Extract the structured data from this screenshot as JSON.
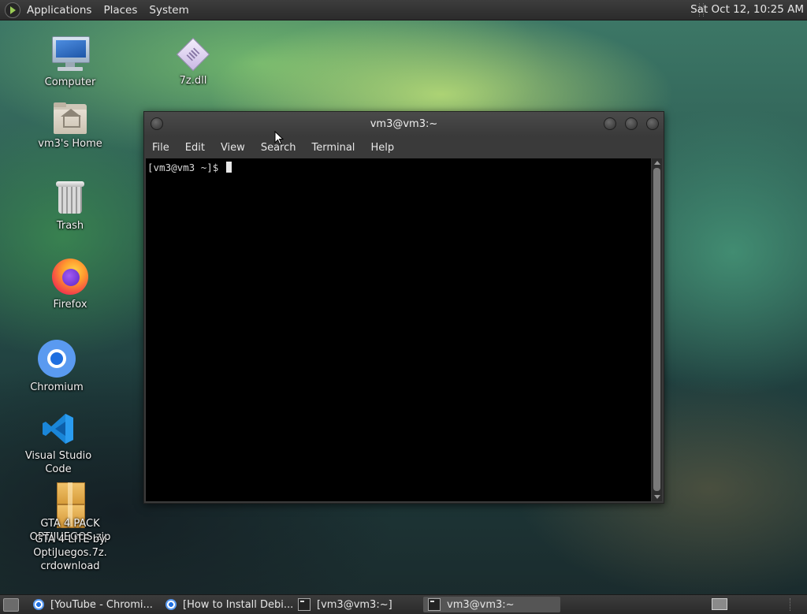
{
  "top_panel": {
    "menus": [
      "Applications",
      "Places",
      "System"
    ],
    "clock": "Sat Oct 12, 10:25 AM"
  },
  "desktop_icons": {
    "computer": "Computer",
    "sevenz": "7z.dll",
    "home": "vm3's Home",
    "trash": "Trash",
    "firefox": "Firefox",
    "chromium": "Chromium",
    "vscode": "Visual Studio Code",
    "gta_line1": "GTA 4 LITE by",
    "gta_line2": "OptiJuegos.7z.",
    "gta_line3": "crdownload",
    "gta_overlap1": "GTA 4 PACK",
    "gta_overlap2": "OPTIJUEGOS.zip"
  },
  "terminal": {
    "title": "vm3@vm3:~",
    "menu": [
      "File",
      "Edit",
      "View",
      "Search",
      "Terminal",
      "Help"
    ],
    "prompt": "[vm3@vm3 ~]$ "
  },
  "taskbar": {
    "tasks": [
      {
        "label": "[YouTube - Chromi...",
        "icon": "chromium-icon"
      },
      {
        "label": "[How to Install Debi...",
        "icon": "chromium-icon"
      },
      {
        "label": "[vm3@vm3:~]",
        "icon": "terminal-icon"
      },
      {
        "label": "vm3@vm3:~",
        "icon": "terminal-icon"
      }
    ]
  },
  "colors": {
    "panel": "#2f2f2f",
    "terminal_bg": "#000000",
    "accent": "#9acb55"
  }
}
